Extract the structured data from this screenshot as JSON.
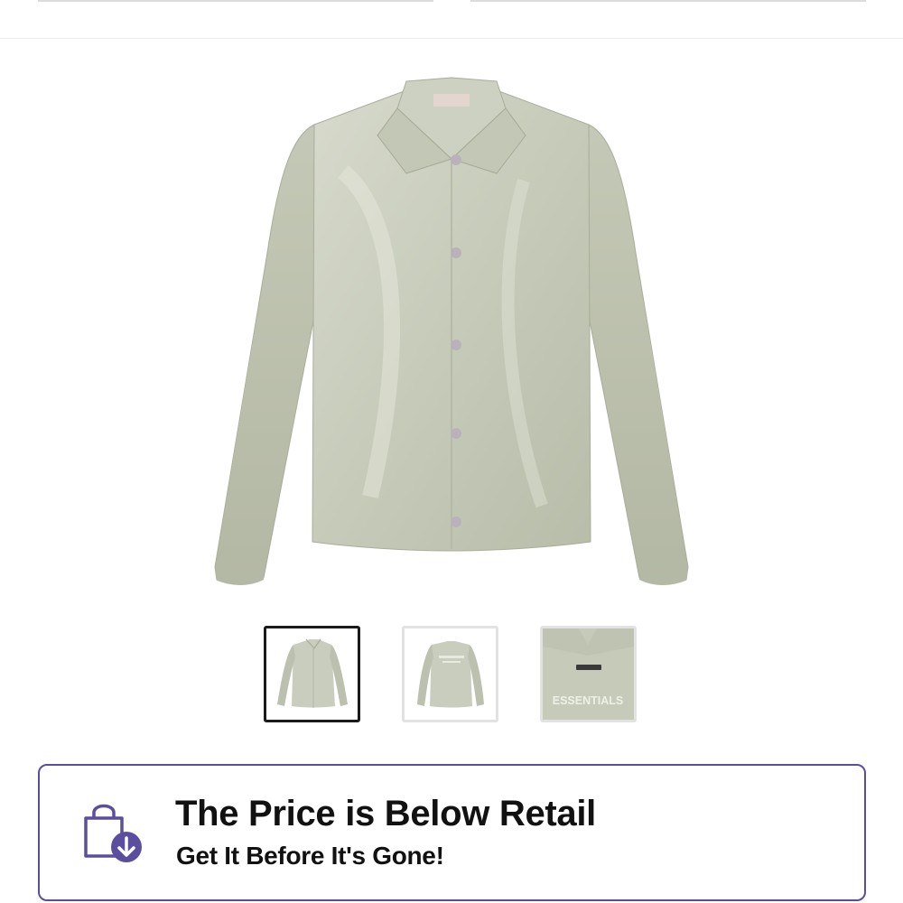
{
  "gallery": {
    "thumbnails": [
      {
        "view": "front",
        "selected": true
      },
      {
        "view": "back",
        "selected": false
      },
      {
        "view": "back-detail",
        "selected": false,
        "label": "ESSENTIALS"
      }
    ]
  },
  "banner": {
    "title": "The Price is Below Retail",
    "subtitle": "Get It Before It's Gone!",
    "icon": "shopping-bag-price-down-icon",
    "accent_color": "#5b4e9e"
  },
  "colors": {
    "product": "#c9cdbd",
    "thumb_active_border": "#1a1a1a",
    "thumb_border": "#e2e2e2"
  }
}
